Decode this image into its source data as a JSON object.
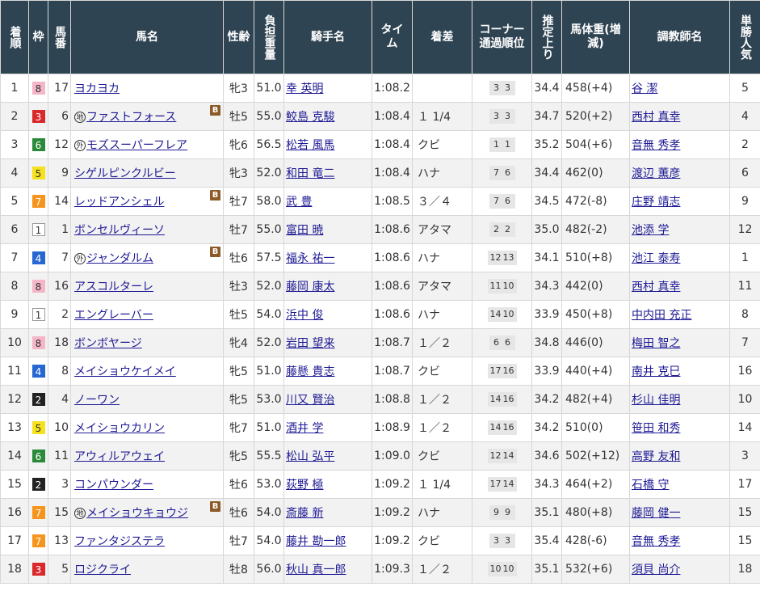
{
  "colors": {
    "header_bg": "#2f4452",
    "link": "#1e1a94",
    "waku": {
      "1": "#ffffff",
      "2": "#222222",
      "3": "#d9292b",
      "4": "#2767d1",
      "5": "#f5e11d",
      "6": "#2a8a3a",
      "7": "#f7941d",
      "8": "#f4b6c8"
    },
    "waku_text": {
      "1": "#333333",
      "2": "#ffffff",
      "3": "#ffffff",
      "4": "#ffffff",
      "5": "#333333",
      "6": "#ffffff",
      "7": "#ffffff",
      "8": "#333333"
    }
  },
  "headers": {
    "rank": "着順",
    "waku": "枠",
    "umaban": "馬番",
    "horse": "馬名",
    "sexage": "性齢",
    "weight": "負担重量",
    "jockey": "騎手名",
    "time": "タイム",
    "margin": "着差",
    "corner": "コーナー通過順位",
    "last3f": "推定上り",
    "body": "馬体重(増減)",
    "trainer": "調教師名",
    "pop": "単勝人気"
  },
  "rows": [
    {
      "rank": "1",
      "waku": "8",
      "umaban": "17",
      "mark": "",
      "horse": "ヨカヨカ",
      "blinker": "",
      "sexage": "牝3",
      "weight": "51.0",
      "jockey": "幸 英明",
      "time": "1:08.2",
      "margin": "",
      "c1": "3",
      "c2": "3",
      "last3f": "34.4",
      "body": "458(+4)",
      "trainer": "谷 潔",
      "pop": "5"
    },
    {
      "rank": "2",
      "waku": "3",
      "umaban": "6",
      "mark": "地",
      "horse": "ファストフォース",
      "blinker": "B",
      "sexage": "牡5",
      "weight": "55.0",
      "jockey": "鮫島 克駿",
      "time": "1:08.4",
      "margin": "１ 1/4",
      "c1": "3",
      "c2": "3",
      "last3f": "34.7",
      "body": "520(+2)",
      "trainer": "西村 真幸",
      "pop": "4"
    },
    {
      "rank": "3",
      "waku": "6",
      "umaban": "12",
      "mark": "外",
      "horse": "モズスーパーフレア",
      "blinker": "",
      "sexage": "牝6",
      "weight": "56.5",
      "jockey": "松若 風馬",
      "time": "1:08.4",
      "margin": "クビ",
      "c1": "1",
      "c2": "1",
      "last3f": "35.2",
      "body": "504(+6)",
      "trainer": "音無 秀孝",
      "pop": "2"
    },
    {
      "rank": "4",
      "waku": "5",
      "umaban": "9",
      "mark": "",
      "horse": "シゲルピンクルビー",
      "blinker": "",
      "sexage": "牝3",
      "weight": "52.0",
      "jockey": "和田 竜二",
      "time": "1:08.4",
      "margin": "ハナ",
      "c1": "7",
      "c2": "6",
      "last3f": "34.4",
      "body": "462(0)",
      "trainer": "渡辺 薫彦",
      "pop": "6"
    },
    {
      "rank": "5",
      "waku": "7",
      "umaban": "14",
      "mark": "",
      "horse": "レッドアンシェル",
      "blinker": "B",
      "sexage": "牡7",
      "weight": "58.0",
      "jockey": "武 豊",
      "time": "1:08.5",
      "margin": "３／４",
      "c1": "7",
      "c2": "6",
      "last3f": "34.5",
      "body": "472(-8)",
      "trainer": "庄野 靖志",
      "pop": "9"
    },
    {
      "rank": "6",
      "waku": "1",
      "umaban": "1",
      "mark": "",
      "horse": "ボンセルヴィーソ",
      "blinker": "",
      "sexage": "牡7",
      "weight": "55.0",
      "jockey": "富田 暁",
      "time": "1:08.6",
      "margin": "アタマ",
      "c1": "2",
      "c2": "2",
      "last3f": "35.0",
      "body": "482(-2)",
      "trainer": "池添 学",
      "pop": "12"
    },
    {
      "rank": "7",
      "waku": "4",
      "umaban": "7",
      "mark": "外",
      "horse": "ジャンダルム",
      "blinker": "B",
      "sexage": "牡6",
      "weight": "57.5",
      "jockey": "福永 祐一",
      "time": "1:08.6",
      "margin": "ハナ",
      "c1": "12",
      "c2": "13",
      "last3f": "34.1",
      "body": "510(+8)",
      "trainer": "池江 泰寿",
      "pop": "1"
    },
    {
      "rank": "8",
      "waku": "8",
      "umaban": "16",
      "mark": "",
      "horse": "アスコルターレ",
      "blinker": "",
      "sexage": "牡3",
      "weight": "52.0",
      "jockey": "藤岡 康太",
      "time": "1:08.6",
      "margin": "アタマ",
      "c1": "11",
      "c2": "10",
      "last3f": "34.3",
      "body": "442(0)",
      "trainer": "西村 真幸",
      "pop": "11"
    },
    {
      "rank": "9",
      "waku": "1",
      "umaban": "2",
      "mark": "",
      "horse": "エングレーバー",
      "blinker": "",
      "sexage": "牡5",
      "weight": "54.0",
      "jockey": "浜中 俊",
      "time": "1:08.6",
      "margin": "ハナ",
      "c1": "14",
      "c2": "10",
      "last3f": "33.9",
      "body": "450(+8)",
      "trainer": "中内田 充正",
      "pop": "8"
    },
    {
      "rank": "10",
      "waku": "8",
      "umaban": "18",
      "mark": "",
      "horse": "ボンボヤージ",
      "blinker": "",
      "sexage": "牝4",
      "weight": "52.0",
      "jockey": "岩田 望来",
      "time": "1:08.7",
      "margin": "１／２",
      "c1": "6",
      "c2": "6",
      "last3f": "34.8",
      "body": "446(0)",
      "trainer": "梅田 智之",
      "pop": "7"
    },
    {
      "rank": "11",
      "waku": "4",
      "umaban": "8",
      "mark": "",
      "horse": "メイショウケイメイ",
      "blinker": "",
      "sexage": "牝5",
      "weight": "51.0",
      "jockey": "藤懸 貴志",
      "time": "1:08.7",
      "margin": "クビ",
      "c1": "17",
      "c2": "16",
      "last3f": "33.9",
      "body": "440(+4)",
      "trainer": "南井 克巳",
      "pop": "16"
    },
    {
      "rank": "12",
      "waku": "2",
      "umaban": "4",
      "mark": "",
      "horse": "ノーワン",
      "blinker": "",
      "sexage": "牝5",
      "weight": "53.0",
      "jockey": "川又 賢治",
      "time": "1:08.8",
      "margin": "１／２",
      "c1": "14",
      "c2": "16",
      "last3f": "34.2",
      "body": "482(+4)",
      "trainer": "杉山 佳明",
      "pop": "10"
    },
    {
      "rank": "13",
      "waku": "5",
      "umaban": "10",
      "mark": "",
      "horse": "メイショウカリン",
      "blinker": "",
      "sexage": "牝7",
      "weight": "51.0",
      "jockey": "酒井 学",
      "time": "1:08.9",
      "margin": "１／２",
      "c1": "14",
      "c2": "16",
      "last3f": "34.2",
      "body": "510(0)",
      "trainer": "笹田 和秀",
      "pop": "14"
    },
    {
      "rank": "14",
      "waku": "6",
      "umaban": "11",
      "mark": "",
      "horse": "アウィルアウェイ",
      "blinker": "",
      "sexage": "牝5",
      "weight": "55.5",
      "jockey": "松山 弘平",
      "time": "1:09.0",
      "margin": "クビ",
      "c1": "12",
      "c2": "14",
      "last3f": "34.6",
      "body": "502(+12)",
      "trainer": "高野 友和",
      "pop": "3"
    },
    {
      "rank": "15",
      "waku": "2",
      "umaban": "3",
      "mark": "",
      "horse": "コンパウンダー",
      "blinker": "",
      "sexage": "牡6",
      "weight": "53.0",
      "jockey": "荻野 極",
      "time": "1:09.2",
      "margin": "１ 1/4",
      "c1": "17",
      "c2": "14",
      "last3f": "34.3",
      "body": "464(+2)",
      "trainer": "石橋 守",
      "pop": "17"
    },
    {
      "rank": "16",
      "waku": "7",
      "umaban": "15",
      "mark": "地",
      "horse": "メイショウキョウジ",
      "blinker": "B",
      "sexage": "牡6",
      "weight": "54.0",
      "jockey": "斎藤 新",
      "time": "1:09.2",
      "margin": "ハナ",
      "c1": "9",
      "c2": "9",
      "last3f": "35.1",
      "body": "480(+8)",
      "trainer": "藤岡 健一",
      "pop": "15"
    },
    {
      "rank": "17",
      "waku": "7",
      "umaban": "13",
      "mark": "",
      "horse": "ファンタジステラ",
      "blinker": "",
      "sexage": "牡7",
      "weight": "54.0",
      "jockey": "藤井 勘一郎",
      "time": "1:09.2",
      "margin": "クビ",
      "c1": "3",
      "c2": "3",
      "last3f": "35.4",
      "body": "428(-6)",
      "trainer": "音無 秀孝",
      "pop": "15"
    },
    {
      "rank": "18",
      "waku": "3",
      "umaban": "5",
      "mark": "",
      "horse": "ロジクライ",
      "blinker": "",
      "sexage": "牡8",
      "weight": "56.0",
      "jockey": "秋山 真一郎",
      "time": "1:09.3",
      "margin": "１／２",
      "c1": "10",
      "c2": "10",
      "last3f": "35.1",
      "body": "532(+6)",
      "trainer": "須貝 尚介",
      "pop": "18"
    }
  ]
}
